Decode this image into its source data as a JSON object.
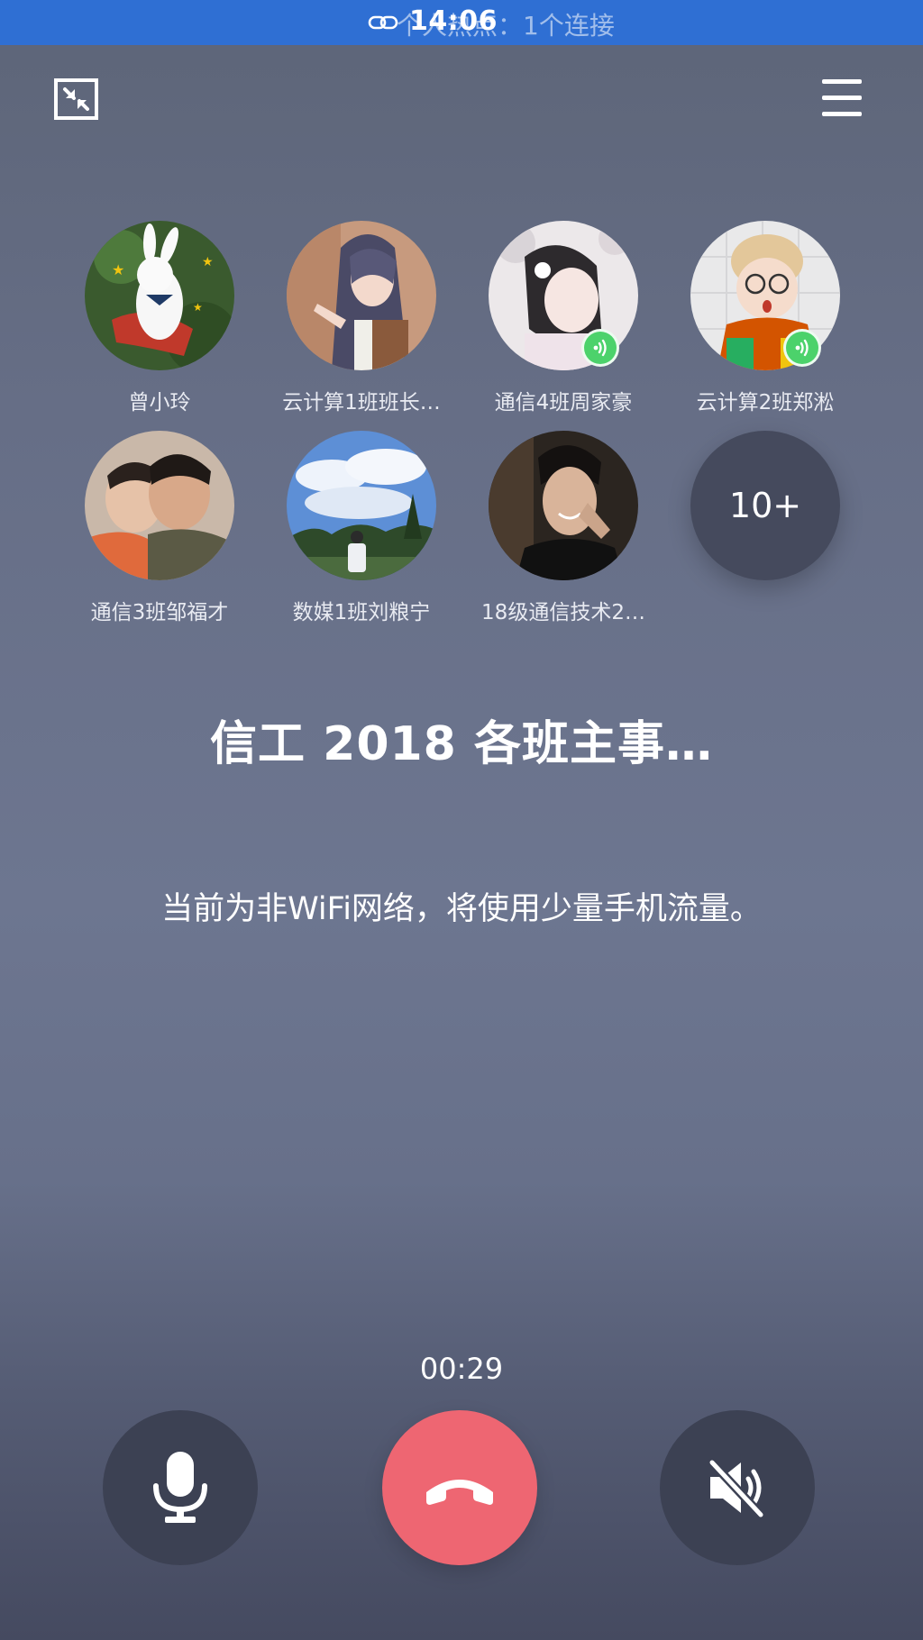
{
  "status_bar": {
    "hotspot_text": "个人热点：1个连接",
    "time": "14:06",
    "background_color": "#2f6fd3"
  },
  "top_controls": {
    "minimize_icon": "minimize-window-icon",
    "menu_icon": "hamburger-menu-icon"
  },
  "participants": [
    {
      "name": "曾小玲",
      "speaking": false
    },
    {
      "name": "云计算1班班长…",
      "speaking": false
    },
    {
      "name": "通信4班周家豪",
      "speaking": true
    },
    {
      "name": "云计算2班郑淞",
      "speaking": true
    },
    {
      "name": "通信3班邹福才",
      "speaking": false
    },
    {
      "name": "数媒1班刘粮宁",
      "speaking": false
    },
    {
      "name": "18级通信技术2…",
      "speaking": false
    }
  ],
  "more_count": "10+",
  "group_title": "信工 2018 各班主事…",
  "network_notice": "当前为非WiFi网络，将使用少量手机流量。",
  "call_timer": "00:29",
  "controls": {
    "microphone_icon": "microphone-icon",
    "hangup_icon": "hang-up-icon",
    "speaker_icon": "speaker-muted-icon",
    "hangup_color": "#ee6672",
    "speaking_badge_color": "#4cd26b"
  }
}
